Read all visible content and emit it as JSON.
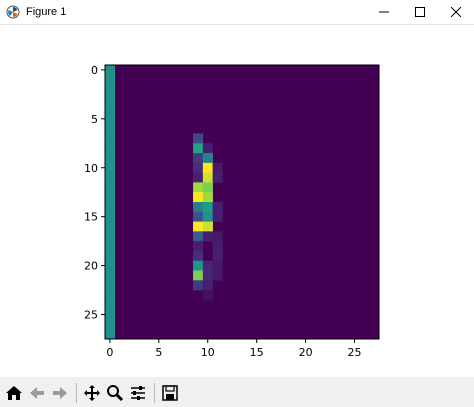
{
  "window": {
    "title": "Figure 1"
  },
  "toolbar": {
    "buttons": [
      "home-icon",
      "back-arrow-icon",
      "forward-arrow-icon",
      "pan-icon",
      "zoom-icon",
      "configure-subplots-icon",
      "save-icon"
    ]
  },
  "colors": {
    "background": "#440154",
    "teal": "#21918c",
    "green": "#35b779",
    "yellow": "#fde725",
    "purple_light": "#482878",
    "purple_mid": "#3e4989",
    "blue": "#31688e"
  },
  "chart_data": {
    "type": "heatmap",
    "grid_size": [
      28,
      28
    ],
    "xticks": [
      0,
      5,
      10,
      15,
      20,
      25
    ],
    "yticks": [
      0,
      5,
      10,
      15,
      20,
      25
    ],
    "xlim": [
      -0.5,
      27.5
    ],
    "ylim": [
      27.5,
      -0.5
    ],
    "colormap": "viridis",
    "value_range": [
      0,
      1
    ],
    "cells": [
      {
        "row": 0,
        "col": 0,
        "v": 0.5
      },
      {
        "row": 1,
        "col": 0,
        "v": 0.5
      },
      {
        "row": 2,
        "col": 0,
        "v": 0.5
      },
      {
        "row": 3,
        "col": 0,
        "v": 0.5
      },
      {
        "row": 4,
        "col": 0,
        "v": 0.5
      },
      {
        "row": 5,
        "col": 0,
        "v": 0.5
      },
      {
        "row": 6,
        "col": 0,
        "v": 0.5
      },
      {
        "row": 7,
        "col": 0,
        "v": 0.5
      },
      {
        "row": 8,
        "col": 0,
        "v": 0.5
      },
      {
        "row": 9,
        "col": 0,
        "v": 0.5
      },
      {
        "row": 10,
        "col": 0,
        "v": 0.5
      },
      {
        "row": 11,
        "col": 0,
        "v": 0.5
      },
      {
        "row": 12,
        "col": 0,
        "v": 0.5
      },
      {
        "row": 13,
        "col": 0,
        "v": 0.5
      },
      {
        "row": 14,
        "col": 0,
        "v": 0.5
      },
      {
        "row": 15,
        "col": 0,
        "v": 0.5
      },
      {
        "row": 16,
        "col": 0,
        "v": 0.5
      },
      {
        "row": 17,
        "col": 0,
        "v": 0.5
      },
      {
        "row": 18,
        "col": 0,
        "v": 0.5
      },
      {
        "row": 19,
        "col": 0,
        "v": 0.5
      },
      {
        "row": 20,
        "col": 0,
        "v": 0.5
      },
      {
        "row": 21,
        "col": 0,
        "v": 0.5
      },
      {
        "row": 22,
        "col": 0,
        "v": 0.5
      },
      {
        "row": 23,
        "col": 0,
        "v": 0.5
      },
      {
        "row": 24,
        "col": 0,
        "v": 0.5
      },
      {
        "row": 25,
        "col": 0,
        "v": 0.5
      },
      {
        "row": 26,
        "col": 0,
        "v": 0.5
      },
      {
        "row": 27,
        "col": 0,
        "v": 0.5
      },
      {
        "row": 7,
        "col": 9,
        "v": 0.25
      },
      {
        "row": 8,
        "col": 9,
        "v": 0.65
      },
      {
        "row": 8,
        "col": 10,
        "v": 0.1
      },
      {
        "row": 9,
        "col": 9,
        "v": 0.2
      },
      {
        "row": 9,
        "col": 10,
        "v": 0.45
      },
      {
        "row": 10,
        "col": 9,
        "v": 0.15
      },
      {
        "row": 10,
        "col": 10,
        "v": 1.0
      },
      {
        "row": 10,
        "col": 11,
        "v": 0.08
      },
      {
        "row": 11,
        "col": 9,
        "v": 0.1
      },
      {
        "row": 11,
        "col": 10,
        "v": 0.95
      },
      {
        "row": 11,
        "col": 11,
        "v": 0.1
      },
      {
        "row": 12,
        "col": 9,
        "v": 0.9
      },
      {
        "row": 12,
        "col": 10,
        "v": 0.85
      },
      {
        "row": 13,
        "col": 9,
        "v": 1.0
      },
      {
        "row": 13,
        "col": 10,
        "v": 0.9
      },
      {
        "row": 14,
        "col": 9,
        "v": 0.45
      },
      {
        "row": 14,
        "col": 10,
        "v": 0.6
      },
      {
        "row": 14,
        "col": 11,
        "v": 0.1
      },
      {
        "row": 15,
        "col": 9,
        "v": 0.3
      },
      {
        "row": 15,
        "col": 10,
        "v": 0.5
      },
      {
        "row": 15,
        "col": 11,
        "v": 0.1
      },
      {
        "row": 16,
        "col": 9,
        "v": 1.0
      },
      {
        "row": 16,
        "col": 10,
        "v": 0.95
      },
      {
        "row": 17,
        "col": 9,
        "v": 0.35
      },
      {
        "row": 17,
        "col": 10,
        "v": 0.1
      },
      {
        "row": 17,
        "col": 11,
        "v": 0.08
      },
      {
        "row": 18,
        "col": 9,
        "v": 0.1
      },
      {
        "row": 18,
        "col": 11,
        "v": 0.1
      },
      {
        "row": 19,
        "col": 9,
        "v": 0.15
      },
      {
        "row": 19,
        "col": 11,
        "v": 0.1
      },
      {
        "row": 20,
        "col": 9,
        "v": 0.55
      },
      {
        "row": 20,
        "col": 10,
        "v": 0.12
      },
      {
        "row": 20,
        "col": 11,
        "v": 0.08
      },
      {
        "row": 21,
        "col": 9,
        "v": 0.85
      },
      {
        "row": 21,
        "col": 10,
        "v": 0.12
      },
      {
        "row": 21,
        "col": 11,
        "v": 0.08
      },
      {
        "row": 22,
        "col": 9,
        "v": 0.2
      },
      {
        "row": 22,
        "col": 10,
        "v": 0.1
      },
      {
        "row": 23,
        "col": 10,
        "v": 0.05
      }
    ]
  }
}
